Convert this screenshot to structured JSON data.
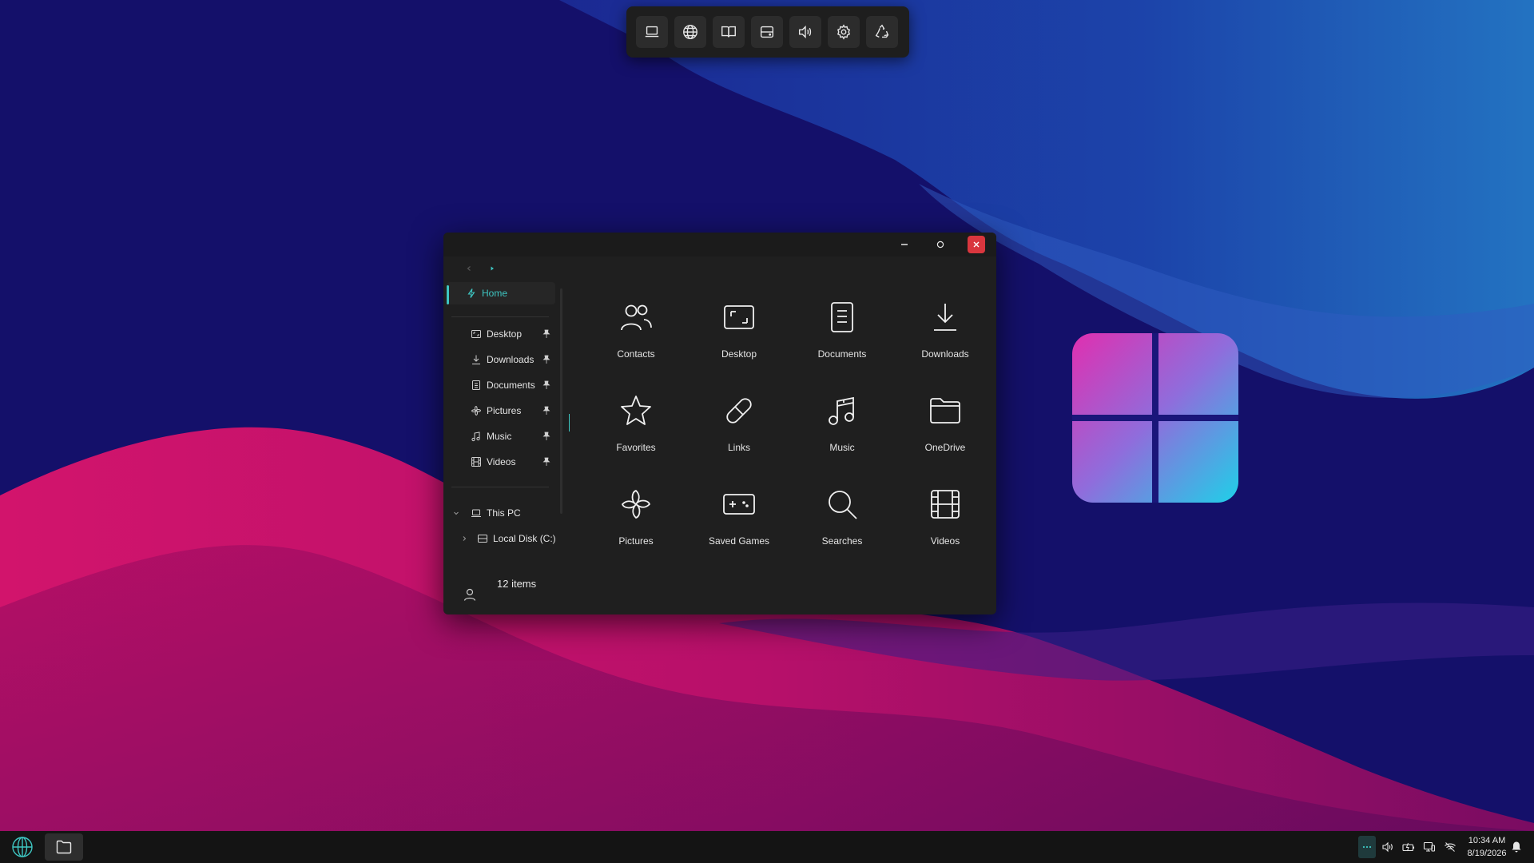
{
  "desktop": {
    "colors": {
      "background": "#15106a",
      "pink": "#c8126a",
      "blue": "#1f4ab0"
    }
  },
  "dock": {
    "items": [
      {
        "icon": "laptop-icon",
        "label": "This PC"
      },
      {
        "icon": "globe-icon",
        "label": "Browser"
      },
      {
        "icon": "book-icon",
        "label": "Reader"
      },
      {
        "icon": "drive-icon",
        "label": "Storage"
      },
      {
        "icon": "volume-icon",
        "label": "Sound"
      },
      {
        "icon": "gear-icon",
        "label": "Settings"
      },
      {
        "icon": "recycle-icon",
        "label": "Recycle Bin"
      }
    ]
  },
  "explorer": {
    "title": "",
    "sidebar": {
      "home_label": "Home",
      "pinned": [
        {
          "label": "Desktop",
          "icon": "desktop-folder-icon"
        },
        {
          "label": "Downloads",
          "icon": "download-icon"
        },
        {
          "label": "Documents",
          "icon": "document-icon"
        },
        {
          "label": "Pictures",
          "icon": "pinwheel-icon"
        },
        {
          "label": "Music",
          "icon": "music-note-icon"
        },
        {
          "label": "Videos",
          "icon": "film-icon"
        }
      ],
      "this_pc_label": "This PC",
      "local_disk_label": "Local Disk (C:)"
    },
    "status": {
      "item_count": "12 items"
    },
    "folders": [
      {
        "label": "Contacts",
        "icon": "contacts-icon"
      },
      {
        "label": "Desktop",
        "icon": "desktop-folder-icon"
      },
      {
        "label": "Documents",
        "icon": "document-icon"
      },
      {
        "label": "Downloads",
        "icon": "download-icon"
      },
      {
        "label": "Favorites",
        "icon": "star-icon"
      },
      {
        "label": "Links",
        "icon": "link-icon"
      },
      {
        "label": "Music",
        "icon": "music-note-icon"
      },
      {
        "label": "OneDrive",
        "icon": "folder-icon"
      },
      {
        "label": "Pictures",
        "icon": "pinwheel-icon"
      },
      {
        "label": "Saved Games",
        "icon": "gamepad-icon"
      },
      {
        "label": "Searches",
        "icon": "search-icon"
      },
      {
        "label": "Videos",
        "icon": "film-icon"
      }
    ],
    "accent_color": "#3ec6c2",
    "close_color": "#d9363e"
  },
  "taskbar": {
    "clock": {
      "time": "10:34 AM",
      "date": "8/19/2026"
    }
  }
}
